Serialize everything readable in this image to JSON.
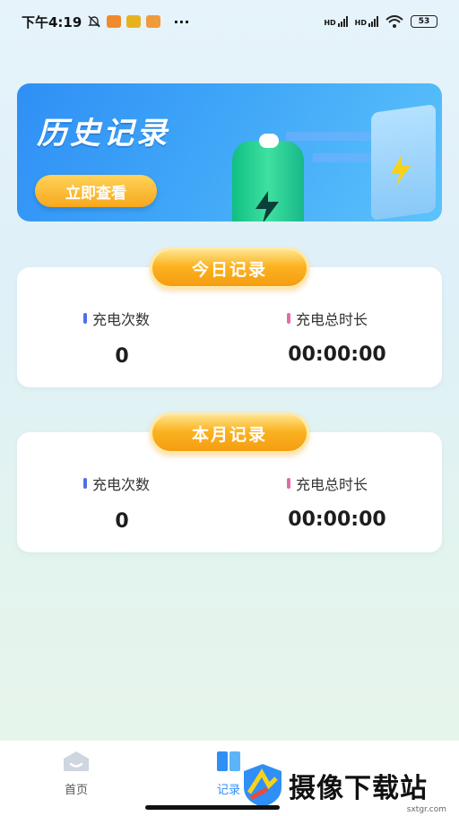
{
  "status_bar": {
    "time": "下午4:19",
    "more": "···",
    "network_hd_1": "HD",
    "network_hd_2": "HD",
    "battery": "53"
  },
  "banner": {
    "title": "历史记录",
    "button_label": "立即查看"
  },
  "today": {
    "tag": "今日记录",
    "count_label": "充电次数",
    "count_value": "0",
    "duration_label": "充电总时长",
    "duration_value": "00:00:00"
  },
  "month": {
    "tag": "本月记录",
    "count_label": "充电次数",
    "count_value": "0",
    "duration_label": "充电总时长",
    "duration_value": "00:00:00"
  },
  "bottom_nav": {
    "items": [
      {
        "label": "首页",
        "icon": "home-icon",
        "active": false
      },
      {
        "label": "记录",
        "icon": "book-icon",
        "active": true
      }
    ]
  },
  "watermark": {
    "text": "摄像下载站",
    "url": "sxtgr.com"
  },
  "colors": {
    "accent_blue": "#2f8ff5",
    "tag_orange": "#f7a81c",
    "count_bar": "#4f6fe8",
    "duration_bar": "#e56aa6"
  }
}
